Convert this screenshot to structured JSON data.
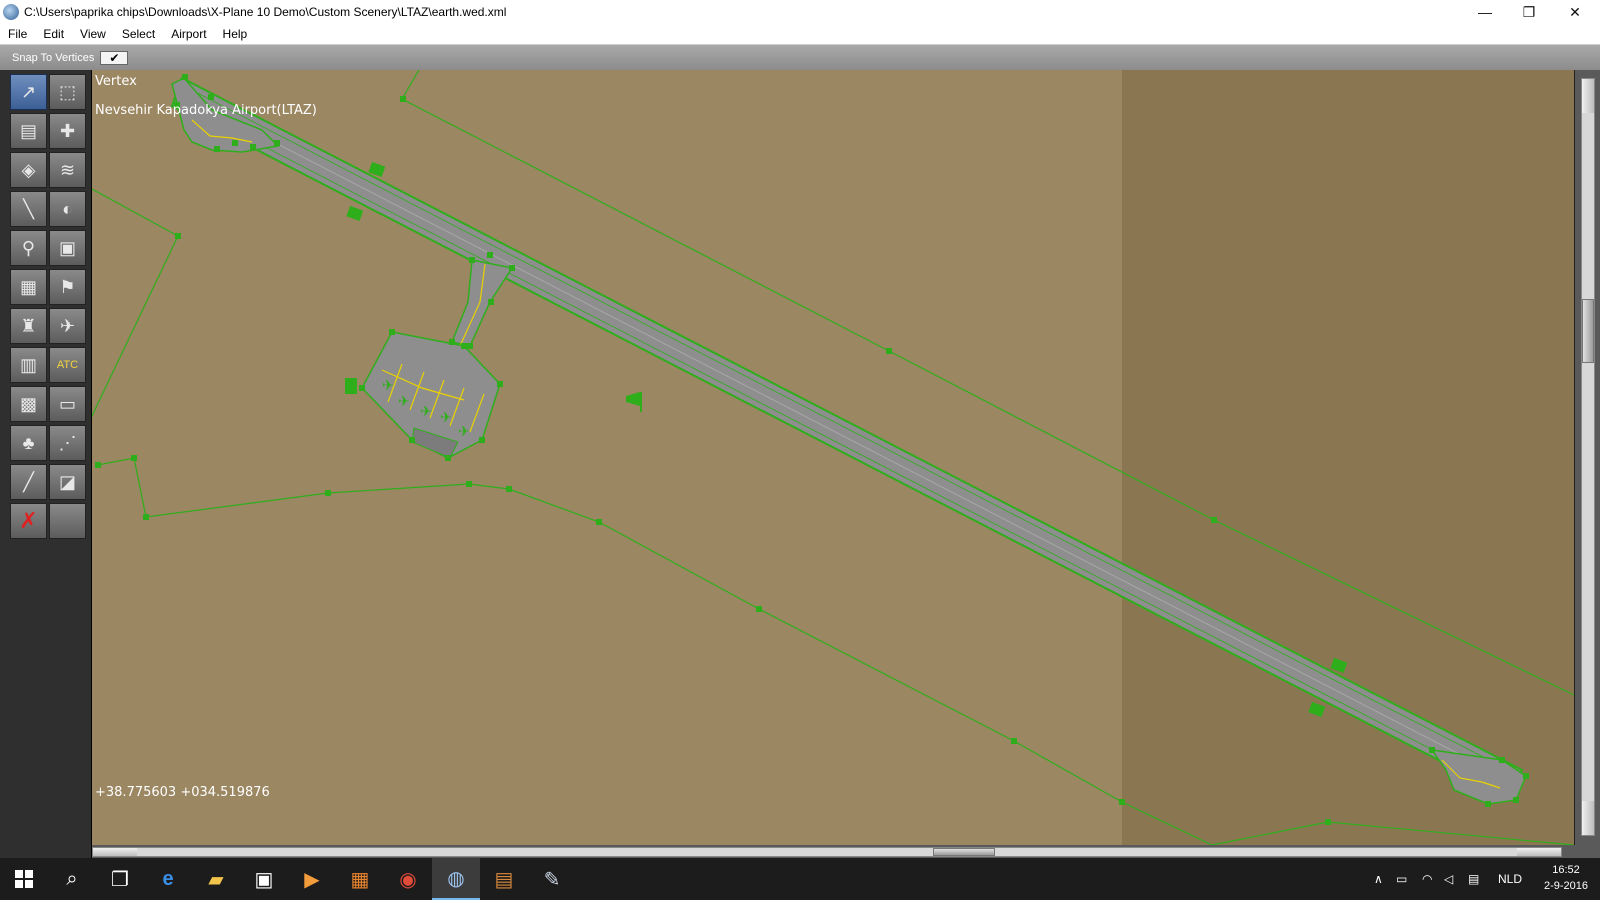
{
  "window": {
    "title": "C:\\Users\\paprika chips\\Downloads\\X-Plane 10 Demo\\Custom Scenery\\LTAZ\\earth.wed.xml",
    "controls": {
      "minimize": "—",
      "maximize": "❐",
      "close": "✕"
    }
  },
  "menu": [
    "File",
    "Edit",
    "View",
    "Select",
    "Airport",
    "Help"
  ],
  "toolbar": {
    "snap_label": "Snap To Vertices",
    "snap_checked": "✔"
  },
  "tools": [
    {
      "name": "vertex-tool",
      "glyph": "↗",
      "active": true
    },
    {
      "name": "marquee-tool",
      "glyph": "⬚",
      "active": false
    },
    {
      "name": "runway-tool",
      "glyph": "▤",
      "active": false
    },
    {
      "name": "helipad-tool",
      "glyph": "✚",
      "active": false
    },
    {
      "name": "taxiway-tool",
      "glyph": "◈",
      "active": false
    },
    {
      "name": "sealane-tool",
      "glyph": "≋",
      "active": false
    },
    {
      "name": "taxiline-tool",
      "glyph": "╲",
      "active": false
    },
    {
      "name": "hole-tool",
      "glyph": "◐",
      "active": false
    },
    {
      "name": "light-fixture-tool",
      "glyph": "⚲",
      "active": false
    },
    {
      "name": "sign-tool",
      "glyph": "▣",
      "active": false
    },
    {
      "name": "boundary-tool",
      "glyph": "▦",
      "active": false
    },
    {
      "name": "windsock-tool",
      "glyph": "⚑",
      "active": false
    },
    {
      "name": "tower-viewpoint-tool",
      "glyph": "♜",
      "active": false
    },
    {
      "name": "ramp-start-tool",
      "glyph": "✈",
      "active": false
    },
    {
      "name": "facade-tool",
      "glyph": "▥",
      "active": false
    },
    {
      "name": "atc-flow-tool",
      "glyph": "ATC",
      "active": false
    },
    {
      "name": "object-tool",
      "glyph": "▩",
      "active": false
    },
    {
      "name": "line-tool",
      "glyph": "▭",
      "active": false
    },
    {
      "name": "forest-tool",
      "glyph": "♣",
      "active": false
    },
    {
      "name": "string-tool",
      "glyph": "⋰",
      "active": false
    },
    {
      "name": "polygon-tool",
      "glyph": "╱",
      "active": false
    },
    {
      "name": "draped-polygon-tool",
      "glyph": "◪",
      "active": false
    },
    {
      "name": "exclusion-tool",
      "glyph": "✗",
      "active": false
    },
    {
      "name": "empty-tool",
      "glyph": "",
      "active": false
    }
  ],
  "map": {
    "mode": "Vertex",
    "airport": "Nevsehir Kapadokya Airport(LTAZ)",
    "coordinates": "+38.775603 +034.519876"
  },
  "taskbar": {
    "language": "NLD",
    "time": "16:52",
    "date": "2-9-2016"
  },
  "colors": {
    "ground": "#9b8762",
    "ground_dark": "#8a7752",
    "pavement": "#8e8e8e",
    "boundary_green": "#2fae1c",
    "taxiline_yellow": "#e8d200"
  }
}
